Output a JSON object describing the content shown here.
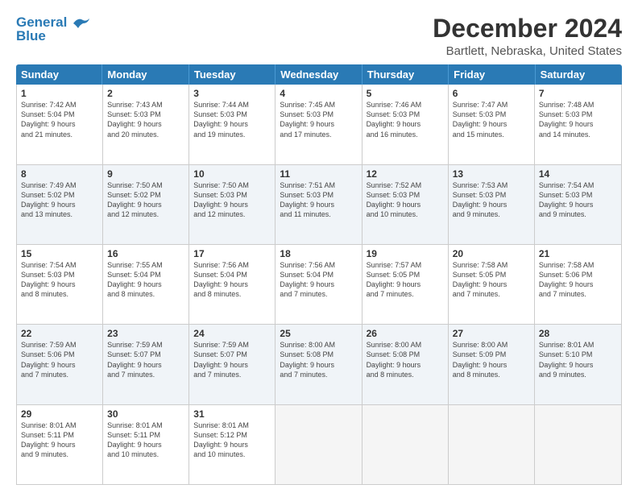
{
  "logo": {
    "line1": "General",
    "line2": "Blue"
  },
  "title": "December 2024",
  "subtitle": "Bartlett, Nebraska, United States",
  "headers": [
    "Sunday",
    "Monday",
    "Tuesday",
    "Wednesday",
    "Thursday",
    "Friday",
    "Saturday"
  ],
  "rows": [
    [
      {
        "day": "1",
        "text": "Sunrise: 7:42 AM\nSunset: 5:04 PM\nDaylight: 9 hours\nand 21 minutes."
      },
      {
        "day": "2",
        "text": "Sunrise: 7:43 AM\nSunset: 5:03 PM\nDaylight: 9 hours\nand 20 minutes."
      },
      {
        "day": "3",
        "text": "Sunrise: 7:44 AM\nSunset: 5:03 PM\nDaylight: 9 hours\nand 19 minutes."
      },
      {
        "day": "4",
        "text": "Sunrise: 7:45 AM\nSunset: 5:03 PM\nDaylight: 9 hours\nand 17 minutes."
      },
      {
        "day": "5",
        "text": "Sunrise: 7:46 AM\nSunset: 5:03 PM\nDaylight: 9 hours\nand 16 minutes."
      },
      {
        "day": "6",
        "text": "Sunrise: 7:47 AM\nSunset: 5:03 PM\nDaylight: 9 hours\nand 15 minutes."
      },
      {
        "day": "7",
        "text": "Sunrise: 7:48 AM\nSunset: 5:03 PM\nDaylight: 9 hours\nand 14 minutes."
      }
    ],
    [
      {
        "day": "8",
        "text": "Sunrise: 7:49 AM\nSunset: 5:02 PM\nDaylight: 9 hours\nand 13 minutes."
      },
      {
        "day": "9",
        "text": "Sunrise: 7:50 AM\nSunset: 5:02 PM\nDaylight: 9 hours\nand 12 minutes."
      },
      {
        "day": "10",
        "text": "Sunrise: 7:50 AM\nSunset: 5:03 PM\nDaylight: 9 hours\nand 12 minutes."
      },
      {
        "day": "11",
        "text": "Sunrise: 7:51 AM\nSunset: 5:03 PM\nDaylight: 9 hours\nand 11 minutes."
      },
      {
        "day": "12",
        "text": "Sunrise: 7:52 AM\nSunset: 5:03 PM\nDaylight: 9 hours\nand 10 minutes."
      },
      {
        "day": "13",
        "text": "Sunrise: 7:53 AM\nSunset: 5:03 PM\nDaylight: 9 hours\nand 9 minutes."
      },
      {
        "day": "14",
        "text": "Sunrise: 7:54 AM\nSunset: 5:03 PM\nDaylight: 9 hours\nand 9 minutes."
      }
    ],
    [
      {
        "day": "15",
        "text": "Sunrise: 7:54 AM\nSunset: 5:03 PM\nDaylight: 9 hours\nand 8 minutes."
      },
      {
        "day": "16",
        "text": "Sunrise: 7:55 AM\nSunset: 5:04 PM\nDaylight: 9 hours\nand 8 minutes."
      },
      {
        "day": "17",
        "text": "Sunrise: 7:56 AM\nSunset: 5:04 PM\nDaylight: 9 hours\nand 8 minutes."
      },
      {
        "day": "18",
        "text": "Sunrise: 7:56 AM\nSunset: 5:04 PM\nDaylight: 9 hours\nand 7 minutes."
      },
      {
        "day": "19",
        "text": "Sunrise: 7:57 AM\nSunset: 5:05 PM\nDaylight: 9 hours\nand 7 minutes."
      },
      {
        "day": "20",
        "text": "Sunrise: 7:58 AM\nSunset: 5:05 PM\nDaylight: 9 hours\nand 7 minutes."
      },
      {
        "day": "21",
        "text": "Sunrise: 7:58 AM\nSunset: 5:06 PM\nDaylight: 9 hours\nand 7 minutes."
      }
    ],
    [
      {
        "day": "22",
        "text": "Sunrise: 7:59 AM\nSunset: 5:06 PM\nDaylight: 9 hours\nand 7 minutes."
      },
      {
        "day": "23",
        "text": "Sunrise: 7:59 AM\nSunset: 5:07 PM\nDaylight: 9 hours\nand 7 minutes."
      },
      {
        "day": "24",
        "text": "Sunrise: 7:59 AM\nSunset: 5:07 PM\nDaylight: 9 hours\nand 7 minutes."
      },
      {
        "day": "25",
        "text": "Sunrise: 8:00 AM\nSunset: 5:08 PM\nDaylight: 9 hours\nand 7 minutes."
      },
      {
        "day": "26",
        "text": "Sunrise: 8:00 AM\nSunset: 5:08 PM\nDaylight: 9 hours\nand 8 minutes."
      },
      {
        "day": "27",
        "text": "Sunrise: 8:00 AM\nSunset: 5:09 PM\nDaylight: 9 hours\nand 8 minutes."
      },
      {
        "day": "28",
        "text": "Sunrise: 8:01 AM\nSunset: 5:10 PM\nDaylight: 9 hours\nand 9 minutes."
      }
    ],
    [
      {
        "day": "29",
        "text": "Sunrise: 8:01 AM\nSunset: 5:11 PM\nDaylight: 9 hours\nand 9 minutes."
      },
      {
        "day": "30",
        "text": "Sunrise: 8:01 AM\nSunset: 5:11 PM\nDaylight: 9 hours\nand 10 minutes."
      },
      {
        "day": "31",
        "text": "Sunrise: 8:01 AM\nSunset: 5:12 PM\nDaylight: 9 hours\nand 10 minutes."
      },
      {
        "day": "",
        "text": ""
      },
      {
        "day": "",
        "text": ""
      },
      {
        "day": "",
        "text": ""
      },
      {
        "day": "",
        "text": ""
      }
    ]
  ]
}
